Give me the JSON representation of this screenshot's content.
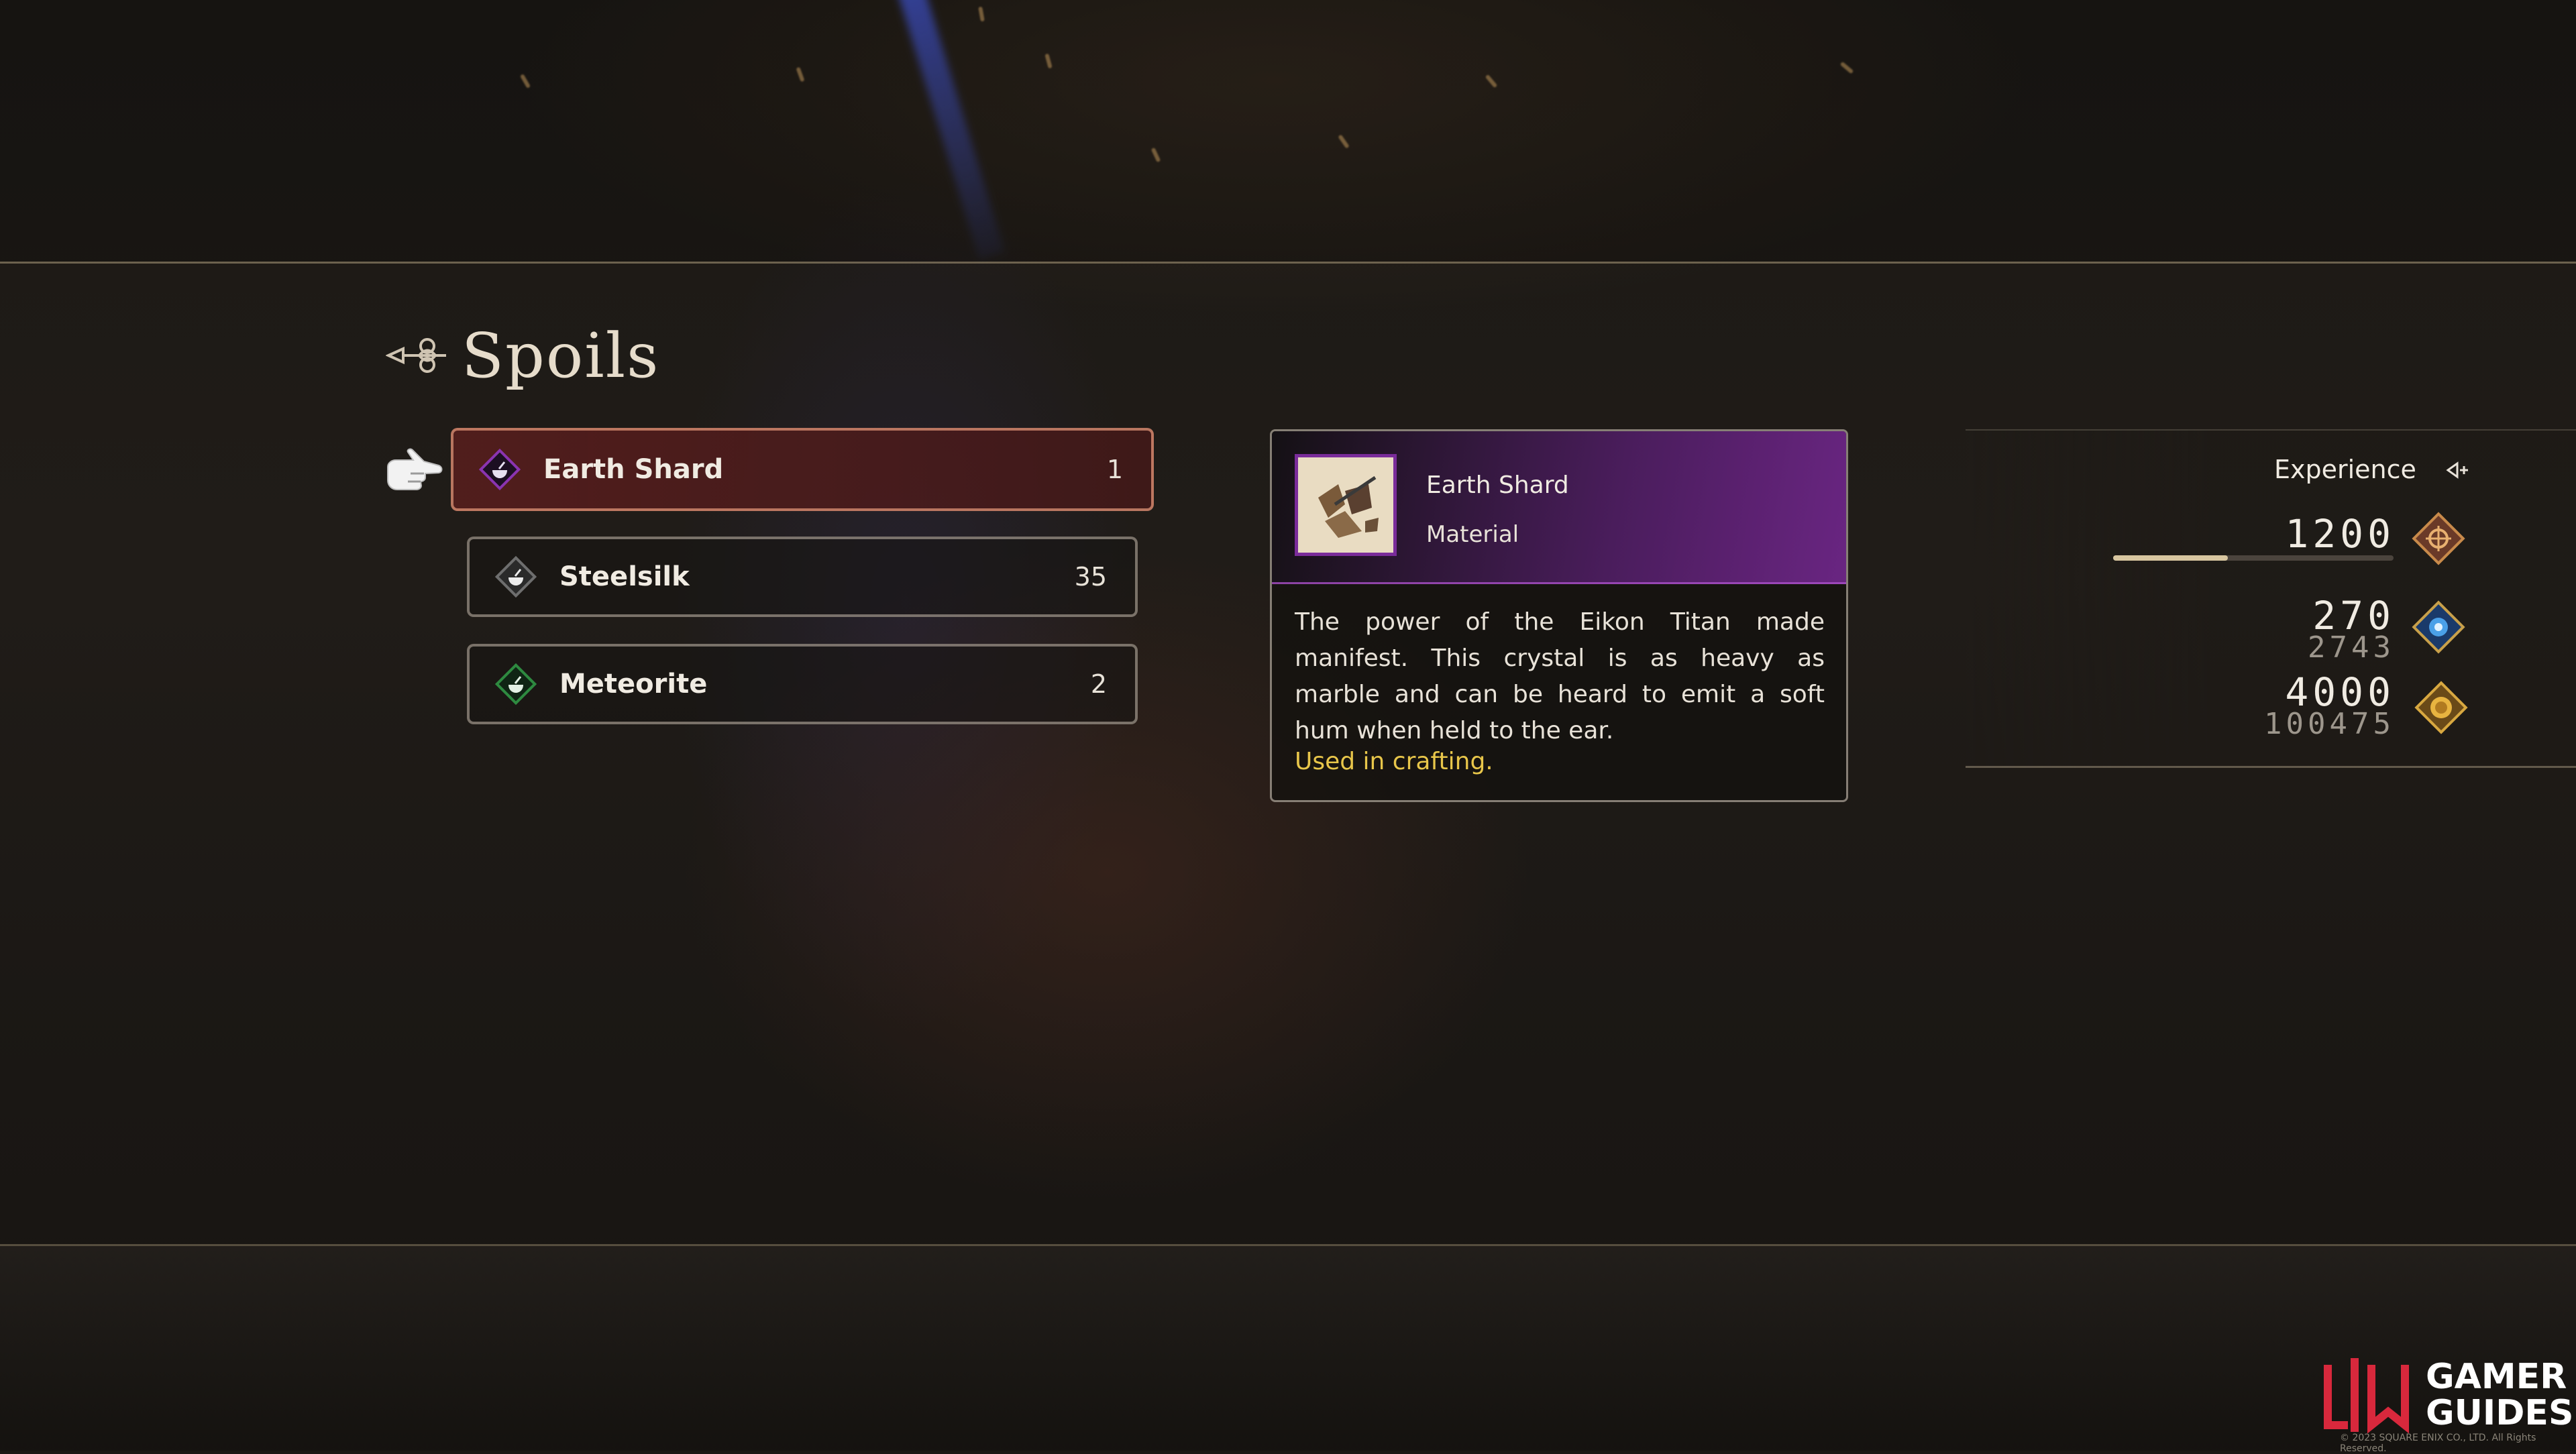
{
  "header": {
    "title": "Spoils"
  },
  "spoils": {
    "items": [
      {
        "name": "Earth Shard",
        "count": "1",
        "diamond_color": "#7a2c9a",
        "icon": "bowl-icon",
        "selected": true
      },
      {
        "name": "Steelsilk",
        "count": "35",
        "diamond_color": "#5a5a5a",
        "icon": "bowl-icon",
        "selected": false
      },
      {
        "name": "Meteorite",
        "count": "2",
        "diamond_color": "#2e7a3a",
        "icon": "bowl-icon",
        "selected": false
      }
    ]
  },
  "detail": {
    "name": "Earth Shard",
    "type": "Material",
    "description": "The power of the Eikon Titan made manifest. This crystal is as heavy as marble and can be heard to emit a soft hum when held to the ear.",
    "note": "Used in crafting.",
    "accent_color": "#7a2c9a",
    "note_color": "#e8c64a"
  },
  "rewards": {
    "experience_label": "Experience",
    "experience_gained": "1200",
    "experience_progress": 0.41,
    "ability_points_gained": "270",
    "ability_points_total": "2743",
    "gil_gained": "4000",
    "gil_total": "100475"
  },
  "watermark": {
    "brand_line1": "GAMER",
    "brand_line2": "GUIDES",
    "copyright": "© 2023 SQUARE ENIX CO., LTD. All Rights Reserved."
  }
}
